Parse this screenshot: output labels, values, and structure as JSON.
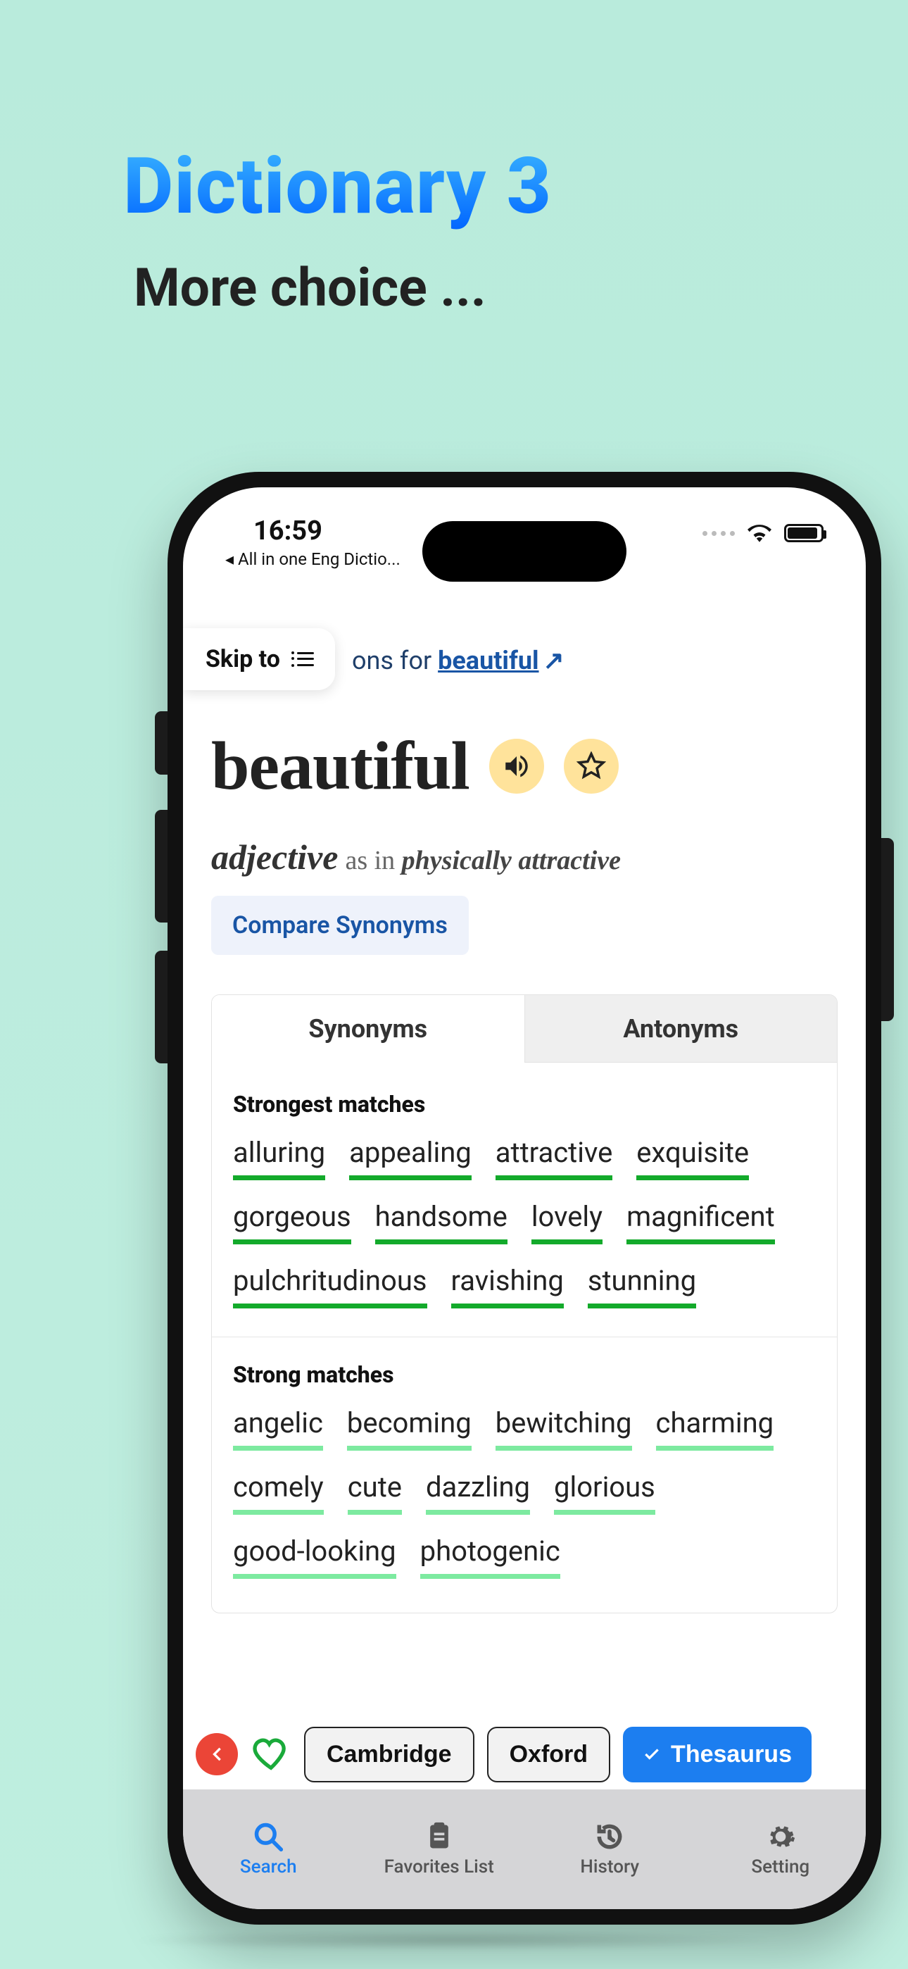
{
  "promo": {
    "title": "Dictionary 3",
    "subtitle": "More choice ..."
  },
  "status": {
    "time": "16:59",
    "back_app": "◂ All in one Eng Dictio..."
  },
  "skip": {
    "label": "Skip to"
  },
  "peek": {
    "prefix": "ons for ",
    "word": "beautiful"
  },
  "entry": {
    "headword": "beautiful",
    "pos": "adjective",
    "as_in_prefix": "as in ",
    "as_in": "physically attractive",
    "compare": "Compare Synonyms"
  },
  "tabs": {
    "synonyms": "Synonyms",
    "antonyms": "Antonyms"
  },
  "groups": {
    "strongest": {
      "label": "Strongest matches",
      "items": [
        "alluring",
        "appealing",
        "attractive",
        "exquisite",
        "gorgeous",
        "handsome",
        "lovely",
        "magnificent",
        "pulchritudinous",
        "ravishing",
        "stunning"
      ]
    },
    "strong": {
      "label": "Strong matches",
      "items": [
        "angelic",
        "becoming",
        "bewitching",
        "charming",
        "comely",
        "cute",
        "dazzling",
        "glorious",
        "good-looking",
        "photogenic"
      ]
    }
  },
  "sources": {
    "cambridge": "Cambridge",
    "oxford": "Oxford",
    "thesaurus": "Thesaurus"
  },
  "nav": {
    "search": "Search",
    "favorites": "Favorites List",
    "history": "History",
    "setting": "Setting"
  }
}
